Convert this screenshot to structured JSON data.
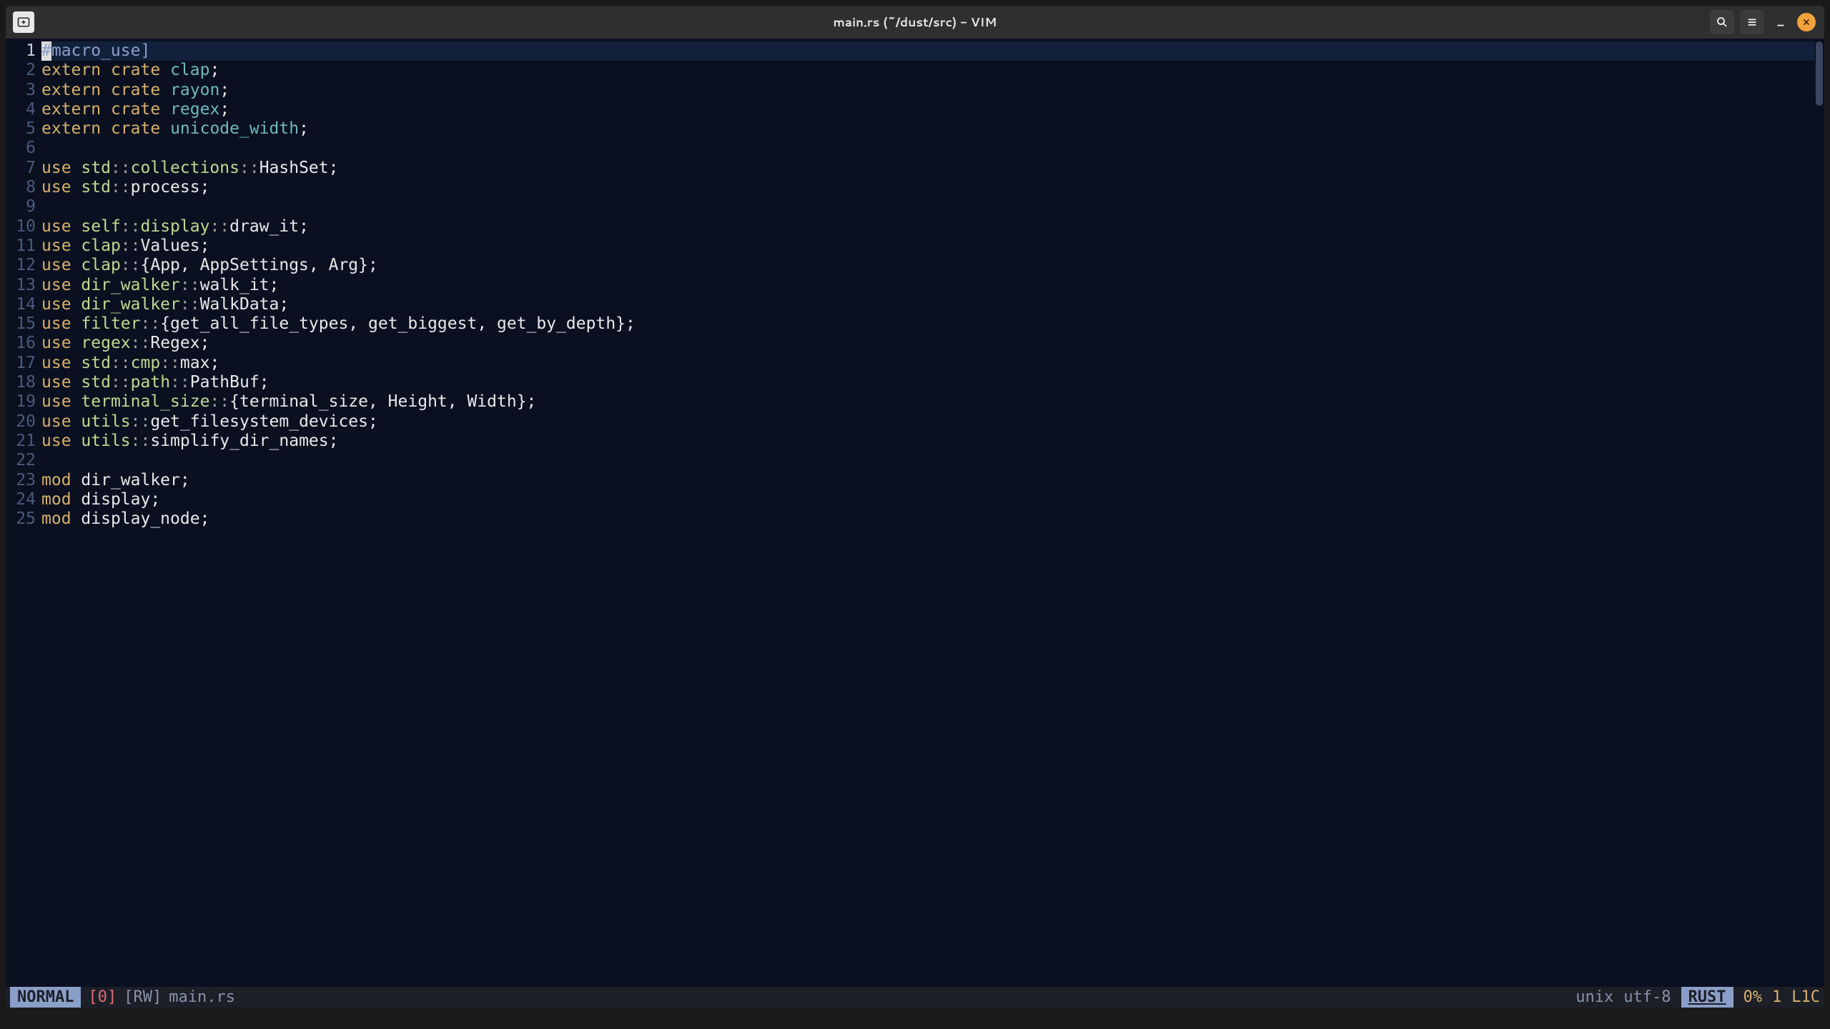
{
  "window": {
    "title": "main.rs (~/dust/src) - VIM"
  },
  "statusbar": {
    "mode": "NORMAL",
    "reg": "[0]",
    "flags": "[RW]",
    "filename": "main.rs",
    "fileformat": "unix",
    "encoding": "utf-8",
    "lang": "RUST",
    "percent": "0%",
    "line": "1",
    "col": "L1C"
  },
  "editor": {
    "cursor_line": 1,
    "lines": [
      {
        "n": 1,
        "tokens": [
          {
            "t": "#",
            "c": "macro",
            "cursor": true
          },
          {
            "t": "[macro_use]",
            "c": "macro"
          }
        ]
      },
      {
        "n": 2,
        "tokens": [
          {
            "t": "extern",
            "c": "kw"
          },
          {
            "t": " "
          },
          {
            "t": "crate",
            "c": "kw"
          },
          {
            "t": " "
          },
          {
            "t": "clap",
            "c": "crate"
          },
          {
            "t": ";",
            "c": "punct"
          }
        ]
      },
      {
        "n": 3,
        "tokens": [
          {
            "t": "extern",
            "c": "kw"
          },
          {
            "t": " "
          },
          {
            "t": "crate",
            "c": "kw"
          },
          {
            "t": " "
          },
          {
            "t": "rayon",
            "c": "crate"
          },
          {
            "t": ";",
            "c": "punct"
          }
        ]
      },
      {
        "n": 4,
        "tokens": [
          {
            "t": "extern",
            "c": "kw"
          },
          {
            "t": " "
          },
          {
            "t": "crate",
            "c": "kw"
          },
          {
            "t": " "
          },
          {
            "t": "regex",
            "c": "crate"
          },
          {
            "t": ";",
            "c": "punct"
          }
        ]
      },
      {
        "n": 5,
        "tokens": [
          {
            "t": "extern",
            "c": "kw"
          },
          {
            "t": " "
          },
          {
            "t": "crate",
            "c": "kw"
          },
          {
            "t": " "
          },
          {
            "t": "unicode_width",
            "c": "crate"
          },
          {
            "t": ";",
            "c": "punct"
          }
        ]
      },
      {
        "n": 6,
        "tokens": []
      },
      {
        "n": 7,
        "tokens": [
          {
            "t": "use",
            "c": "kw"
          },
          {
            "t": " "
          },
          {
            "t": "std",
            "c": "path"
          },
          {
            "t": "::",
            "c": "sep"
          },
          {
            "t": "collections",
            "c": "path"
          },
          {
            "t": "::",
            "c": "sep"
          },
          {
            "t": "HashSet",
            "c": "item"
          },
          {
            "t": ";",
            "c": "punct"
          }
        ]
      },
      {
        "n": 8,
        "tokens": [
          {
            "t": "use",
            "c": "kw"
          },
          {
            "t": " "
          },
          {
            "t": "std",
            "c": "path"
          },
          {
            "t": "::",
            "c": "sep"
          },
          {
            "t": "process",
            "c": "item"
          },
          {
            "t": ";",
            "c": "punct"
          }
        ]
      },
      {
        "n": 9,
        "tokens": []
      },
      {
        "n": 10,
        "tokens": [
          {
            "t": "use",
            "c": "kw"
          },
          {
            "t": " "
          },
          {
            "t": "self",
            "c": "path"
          },
          {
            "t": "::",
            "c": "sep"
          },
          {
            "t": "display",
            "c": "path"
          },
          {
            "t": "::",
            "c": "sep"
          },
          {
            "t": "draw_it",
            "c": "item"
          },
          {
            "t": ";",
            "c": "punct"
          }
        ]
      },
      {
        "n": 11,
        "tokens": [
          {
            "t": "use",
            "c": "kw"
          },
          {
            "t": " "
          },
          {
            "t": "clap",
            "c": "path"
          },
          {
            "t": "::",
            "c": "sep"
          },
          {
            "t": "Values",
            "c": "item"
          },
          {
            "t": ";",
            "c": "punct"
          }
        ]
      },
      {
        "n": 12,
        "tokens": [
          {
            "t": "use",
            "c": "kw"
          },
          {
            "t": " "
          },
          {
            "t": "clap",
            "c": "path"
          },
          {
            "t": "::",
            "c": "sep"
          },
          {
            "t": "{App, AppSettings, Arg}",
            "c": "item"
          },
          {
            "t": ";",
            "c": "punct"
          }
        ]
      },
      {
        "n": 13,
        "tokens": [
          {
            "t": "use",
            "c": "kw"
          },
          {
            "t": " "
          },
          {
            "t": "dir_walker",
            "c": "path"
          },
          {
            "t": "::",
            "c": "sep"
          },
          {
            "t": "walk_it",
            "c": "item"
          },
          {
            "t": ";",
            "c": "punct"
          }
        ]
      },
      {
        "n": 14,
        "tokens": [
          {
            "t": "use",
            "c": "kw"
          },
          {
            "t": " "
          },
          {
            "t": "dir_walker",
            "c": "path"
          },
          {
            "t": "::",
            "c": "sep"
          },
          {
            "t": "WalkData",
            "c": "item"
          },
          {
            "t": ";",
            "c": "punct"
          }
        ]
      },
      {
        "n": 15,
        "tokens": [
          {
            "t": "use",
            "c": "kw"
          },
          {
            "t": " "
          },
          {
            "t": "filter",
            "c": "path"
          },
          {
            "t": "::",
            "c": "sep"
          },
          {
            "t": "{get_all_file_types, get_biggest, get_by_depth}",
            "c": "item"
          },
          {
            "t": ";",
            "c": "punct"
          }
        ]
      },
      {
        "n": 16,
        "tokens": [
          {
            "t": "use",
            "c": "kw"
          },
          {
            "t": " "
          },
          {
            "t": "regex",
            "c": "path"
          },
          {
            "t": "::",
            "c": "sep"
          },
          {
            "t": "Regex",
            "c": "item"
          },
          {
            "t": ";",
            "c": "punct"
          }
        ]
      },
      {
        "n": 17,
        "tokens": [
          {
            "t": "use",
            "c": "kw"
          },
          {
            "t": " "
          },
          {
            "t": "std",
            "c": "path"
          },
          {
            "t": "::",
            "c": "sep"
          },
          {
            "t": "cmp",
            "c": "path"
          },
          {
            "t": "::",
            "c": "sep"
          },
          {
            "t": "max",
            "c": "item"
          },
          {
            "t": ";",
            "c": "punct"
          }
        ]
      },
      {
        "n": 18,
        "tokens": [
          {
            "t": "use",
            "c": "kw"
          },
          {
            "t": " "
          },
          {
            "t": "std",
            "c": "path"
          },
          {
            "t": "::",
            "c": "sep"
          },
          {
            "t": "path",
            "c": "path"
          },
          {
            "t": "::",
            "c": "sep"
          },
          {
            "t": "PathBuf",
            "c": "item"
          },
          {
            "t": ";",
            "c": "punct"
          }
        ]
      },
      {
        "n": 19,
        "tokens": [
          {
            "t": "use",
            "c": "kw"
          },
          {
            "t": " "
          },
          {
            "t": "terminal_size",
            "c": "path"
          },
          {
            "t": "::",
            "c": "sep"
          },
          {
            "t": "{terminal_size, Height, Width}",
            "c": "item"
          },
          {
            "t": ";",
            "c": "punct"
          }
        ]
      },
      {
        "n": 20,
        "tokens": [
          {
            "t": "use",
            "c": "kw"
          },
          {
            "t": " "
          },
          {
            "t": "utils",
            "c": "path"
          },
          {
            "t": "::",
            "c": "sep"
          },
          {
            "t": "get_filesystem_devices",
            "c": "item"
          },
          {
            "t": ";",
            "c": "punct"
          }
        ]
      },
      {
        "n": 21,
        "tokens": [
          {
            "t": "use",
            "c": "kw"
          },
          {
            "t": " "
          },
          {
            "t": "utils",
            "c": "path"
          },
          {
            "t": "::",
            "c": "sep"
          },
          {
            "t": "simplify_dir_names",
            "c": "item"
          },
          {
            "t": ";",
            "c": "punct"
          }
        ]
      },
      {
        "n": 22,
        "tokens": []
      },
      {
        "n": 23,
        "tokens": [
          {
            "t": "mod",
            "c": "kw"
          },
          {
            "t": " "
          },
          {
            "t": "dir_walker",
            "c": "item"
          },
          {
            "t": ";",
            "c": "punct"
          }
        ]
      },
      {
        "n": 24,
        "tokens": [
          {
            "t": "mod",
            "c": "kw"
          },
          {
            "t": " "
          },
          {
            "t": "display",
            "c": "item"
          },
          {
            "t": ";",
            "c": "punct"
          }
        ]
      },
      {
        "n": 25,
        "tokens": [
          {
            "t": "mod",
            "c": "kw"
          },
          {
            "t": " "
          },
          {
            "t": "display_node",
            "c": "item"
          },
          {
            "t": ";",
            "c": "punct"
          }
        ]
      }
    ]
  }
}
